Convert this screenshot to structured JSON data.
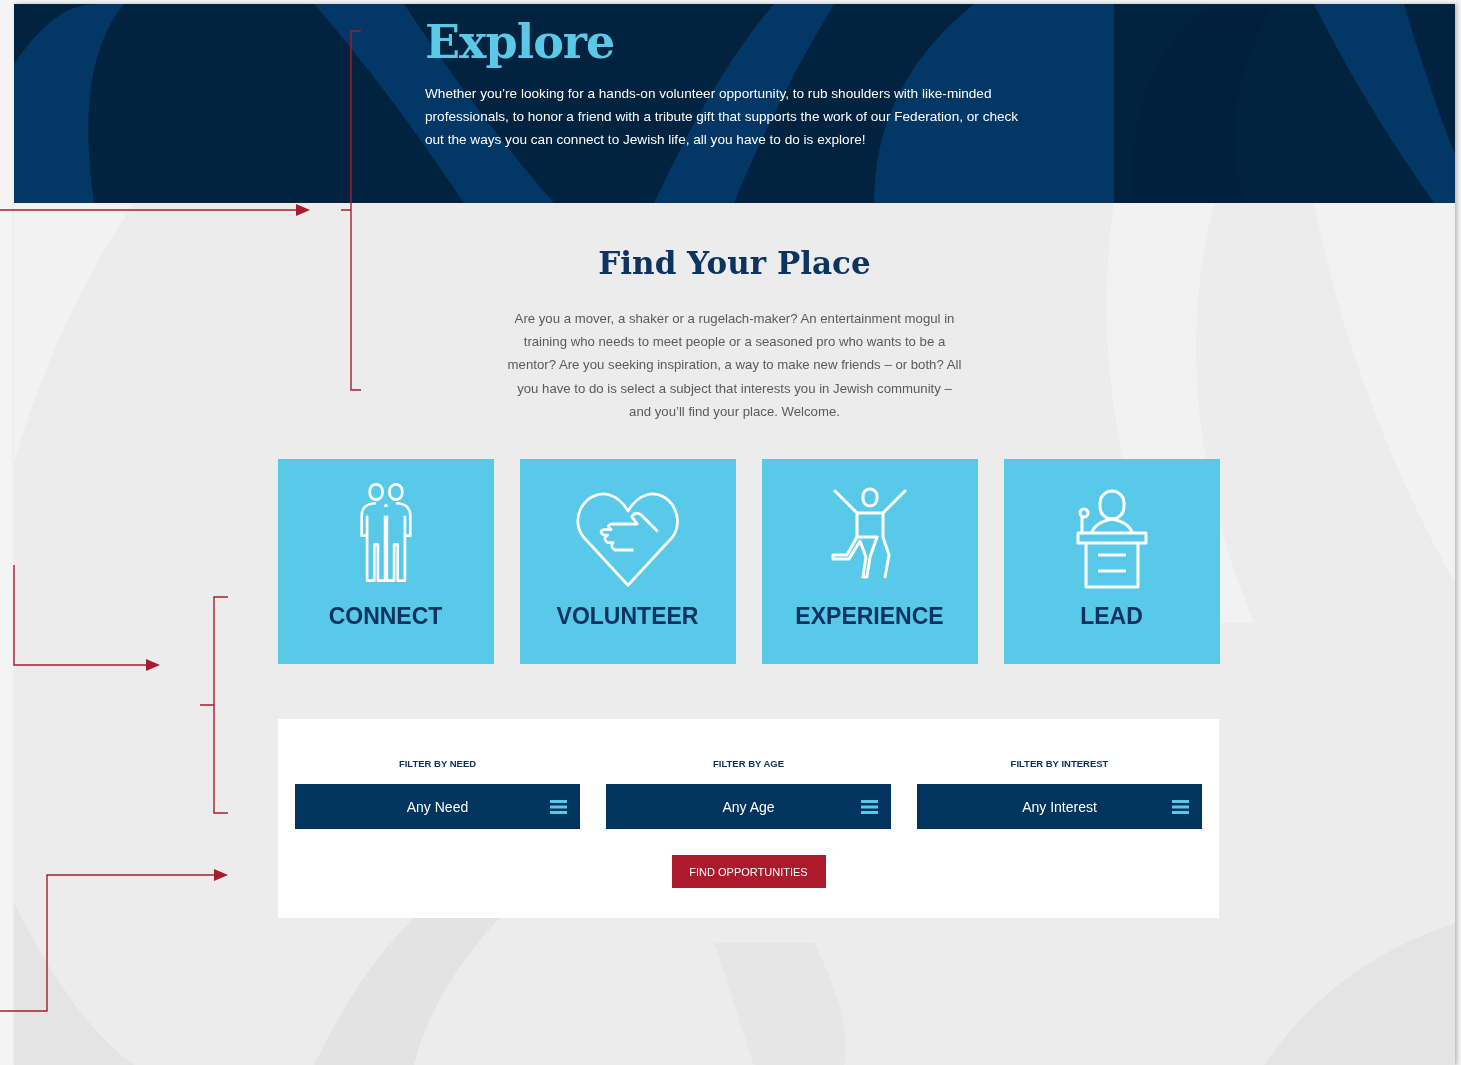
{
  "hero": {
    "title": "Explore",
    "text": "Whether you’re looking for a hands-on volunteer opportunity, to rub shoulders with like-minded professionals, to honor a friend with a tribute gift that supports the work of our Federation, or check out the ways you can connect to Jewish life, all you have to do is explore!"
  },
  "intro": {
    "title": "Find Your Place",
    "text": "Are you a mover, a shaker or a rugelach-maker? An entertainment mogul in training who needs to meet people or a seasoned pro who wants to be a mentor? Are you seeking inspiration, a way to make new friends – or both? All you have to do is select a subject that interests you in Jewish community – and you’ll find your place. Welcome."
  },
  "categories": [
    {
      "label": "CONNECT",
      "kind": "people"
    },
    {
      "label": "VOLUNTEER",
      "kind": "heart"
    },
    {
      "label": "EXPERIENCE",
      "kind": "jumper"
    },
    {
      "label": "LEAD",
      "kind": "speaker"
    }
  ],
  "filters": [
    {
      "label": "FILTER BY NEED",
      "value": "Any Need"
    },
    {
      "label": "FILTER BY AGE",
      "value": "Any Age"
    },
    {
      "label": "FILTER BY INTEREST",
      "value": "Any Interest"
    }
  ],
  "button": "FIND OPPORTUNITIES"
}
